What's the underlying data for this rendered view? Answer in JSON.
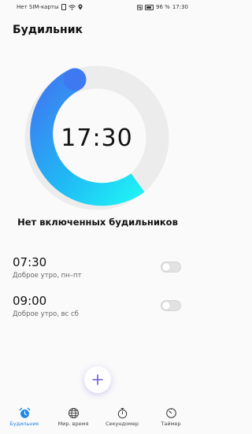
{
  "status_bar": {
    "carrier": "Нет SIM-карты",
    "battery": "96 %",
    "time": "17:30"
  },
  "header": {
    "title": "Будильник"
  },
  "dial": {
    "time": "17:30",
    "arc_start": "#3f79f1",
    "arc_end": "#20e0f7"
  },
  "empty_message": "Нет включенных будильников",
  "alarms": [
    {
      "time": "07:30",
      "subtitle": "Доброе утро, пн–пт",
      "enabled": false
    },
    {
      "time": "09:00",
      "subtitle": "Доброе утро, вс сб",
      "enabled": false
    }
  ],
  "add_button": {
    "icon": "plus-icon",
    "color": "#6b5bd6"
  },
  "bottom_nav": {
    "active_color": "#1e88e5",
    "items": [
      {
        "label": "Будильник",
        "icon": "alarm-clock-icon",
        "active": true
      },
      {
        "label": "Мир. время",
        "icon": "globe-icon",
        "active": false
      },
      {
        "label": "Секундомер",
        "icon": "stopwatch-icon",
        "active": false
      },
      {
        "label": "Таймер",
        "icon": "timer-icon",
        "active": false
      }
    ]
  }
}
